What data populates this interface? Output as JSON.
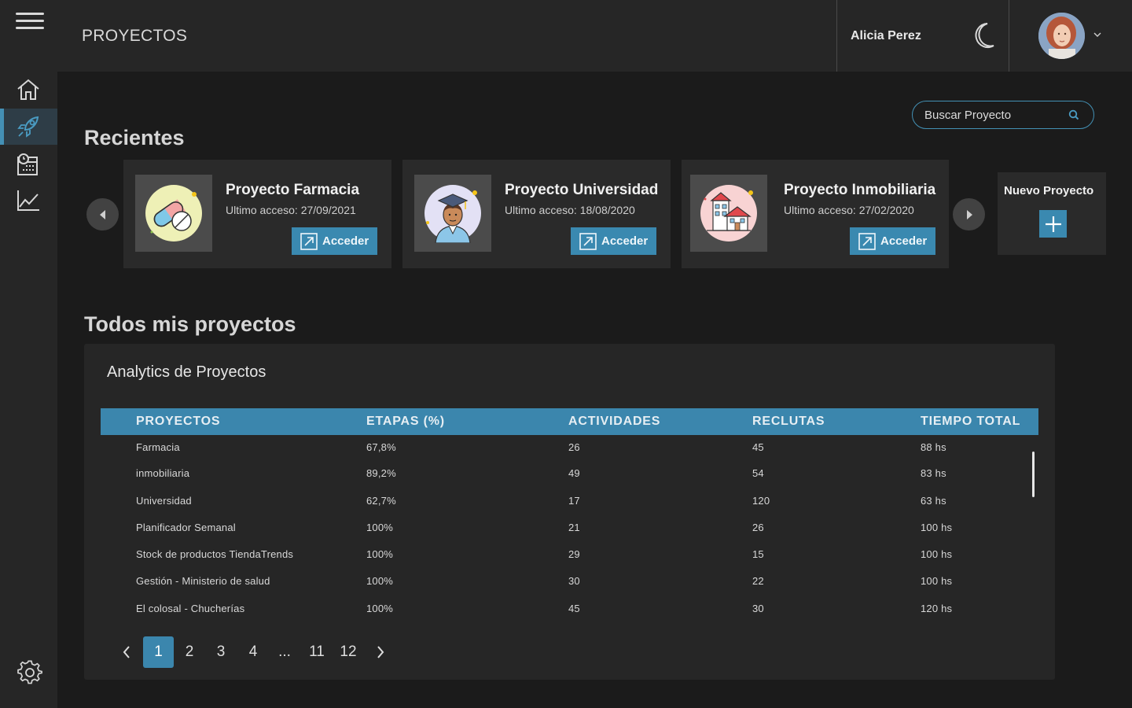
{
  "header": {
    "page_title": "PROYECTOS",
    "user_name": "Alicia Perez"
  },
  "search": {
    "placeholder": "Buscar Proyecto"
  },
  "recientes": {
    "title": "Recientes",
    "cards": [
      {
        "title": "Proyecto Farmacia",
        "last_access": "Ultimo acceso: 27/09/2021",
        "button": "Acceder",
        "icon": "pills-icon"
      },
      {
        "title": "Proyecto Universidad",
        "last_access": "Ultimo acceso: 18/08/2020",
        "button": "Acceder",
        "icon": "graduate-icon"
      },
      {
        "title": "Proyecto Inmobiliaria",
        "last_access": "Ultimo acceso: 27/02/2020",
        "button": "Acceder",
        "icon": "houses-icon"
      }
    ],
    "new_project": "Nuevo Proyecto"
  },
  "todos": {
    "title": "Todos mis proyectos"
  },
  "analytics": {
    "title": "Analytics de Proyectos",
    "columns": [
      "PROYECTOS",
      "ETAPAS (%)",
      "ACTIVIDADES",
      "RECLUTAS",
      "TIEMPO TOTAL"
    ],
    "rows": [
      [
        "Farmacia",
        "67,8%",
        "26",
        "45",
        "88 hs"
      ],
      [
        "inmobiliaria",
        "89,2%",
        "49",
        "54",
        "83 hs"
      ],
      [
        "Universidad",
        "62,7%",
        "17",
        "120",
        "63 hs"
      ],
      [
        "Planificador Semanal",
        "100%",
        "21",
        "26",
        "100 hs"
      ],
      [
        "Stock de productos TiendaTrends",
        "100%",
        "29",
        "15",
        "100 hs"
      ],
      [
        "Gestión - Ministerio de salud",
        "100%",
        "30",
        "22",
        "100 hs"
      ],
      [
        "El colosal - Chucherías",
        "100%",
        "45",
        "30",
        "120 hs"
      ]
    ]
  },
  "pagination": {
    "pages": [
      "1",
      "2",
      "3",
      "4",
      "...",
      "11",
      "12"
    ],
    "current": "1"
  },
  "colors": {
    "accent": "#3b86ad",
    "background": "#1b1b1b",
    "panel": "#262626"
  }
}
